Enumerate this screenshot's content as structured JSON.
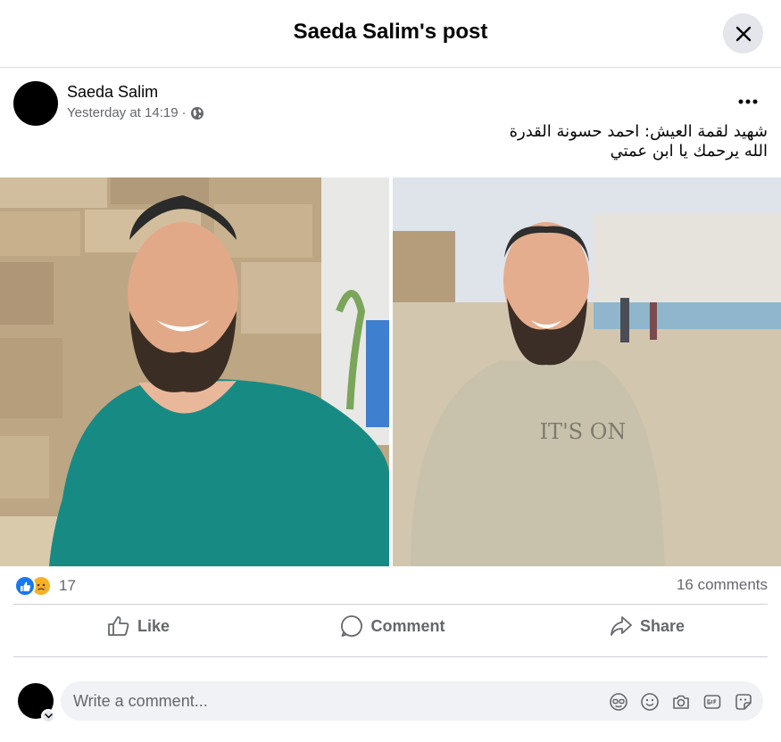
{
  "dialog": {
    "title": "Saeda Salim's post",
    "close_icon": "close-icon"
  },
  "post": {
    "author": "Saeda Salim",
    "timestamp": "Yesterday at 14:19",
    "separator": "·",
    "privacy_icon": "globe-icon",
    "more_icon": "more-options-icon",
    "text_line1": "شهيد لقمة العيش: احمد حسونة القدرة",
    "text_line2": "الله يرحمك يا ابن عمتي",
    "photos": [
      {
        "name": "photo-left",
        "overlay_text": ""
      },
      {
        "name": "photo-right",
        "overlay_text": "IT'S ON"
      }
    ]
  },
  "engagement": {
    "reaction_icons": [
      "like-reaction-icon",
      "sad-reaction-icon"
    ],
    "reaction_count": "17",
    "comments_label": "16 comments"
  },
  "actions": {
    "like_label": "Like",
    "comment_label": "Comment",
    "share_label": "Share"
  },
  "composer": {
    "placeholder": "Write a comment...",
    "tools": [
      "avatar-sticker-icon",
      "emoji-icon",
      "camera-icon",
      "gif-icon",
      "sticker-icon"
    ]
  },
  "colors": {
    "accent": "#1877f2",
    "secondary_text": "#65676b",
    "divider": "#ced0d4",
    "input_bg": "#f0f2f5"
  }
}
